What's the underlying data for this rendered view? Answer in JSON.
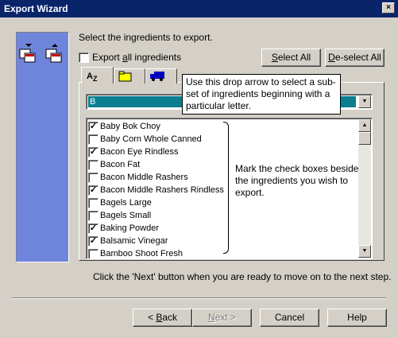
{
  "window": {
    "title": "Export Wizard",
    "close_glyph": "×"
  },
  "instruction": "Select the ingredients to export.",
  "export_all": {
    "label_pre": "Export ",
    "label_u": "a",
    "label_post": "ll ingredients",
    "checked": false
  },
  "buttons": {
    "select_all": {
      "u": "S",
      "rest": "elect All"
    },
    "deselect_all": {
      "u": "D",
      "rest": "e-select All"
    },
    "back": {
      "pre": "< ",
      "u": "B",
      "rest": "ack"
    },
    "next": {
      "u": "N",
      "rest": "ext >"
    },
    "cancel": "Cancel",
    "help": "Help"
  },
  "tabs": [
    {
      "name": "alphabetical",
      "icon": "az-sort-icon",
      "text": "AZ"
    },
    {
      "name": "category",
      "icon": "folder-icon"
    },
    {
      "name": "supplier",
      "icon": "truck-icon"
    }
  ],
  "letter_filter": {
    "value": "B"
  },
  "ingredients": [
    {
      "label": "Baby Bok Choy",
      "checked": true
    },
    {
      "label": "Baby Corn Whole Canned",
      "checked": false
    },
    {
      "label": "Bacon Eye Rindless",
      "checked": true
    },
    {
      "label": "Bacon Fat",
      "checked": false
    },
    {
      "label": "Bacon Middle Rashers",
      "checked": false
    },
    {
      "label": "Bacon Middle Rashers Rindless",
      "checked": true
    },
    {
      "label": "Bagels Large",
      "checked": false
    },
    {
      "label": "Bagels Small",
      "checked": false
    },
    {
      "label": "Baking Powder",
      "checked": true
    },
    {
      "label": "Balsamic Vinegar",
      "checked": true
    },
    {
      "label": "Bamboo Shoot Fresh",
      "checked": false
    }
  ],
  "callout_dropdown": "Use this drop arrow to select a sub-set of ingredients beginning with a particular letter.",
  "callout_checkboxes": "Mark the check boxes beside the ingredients you wish to export.",
  "footer_hint": "Click the 'Next' button when you are ready to move on to the next step.",
  "check_glyph": "✓"
}
